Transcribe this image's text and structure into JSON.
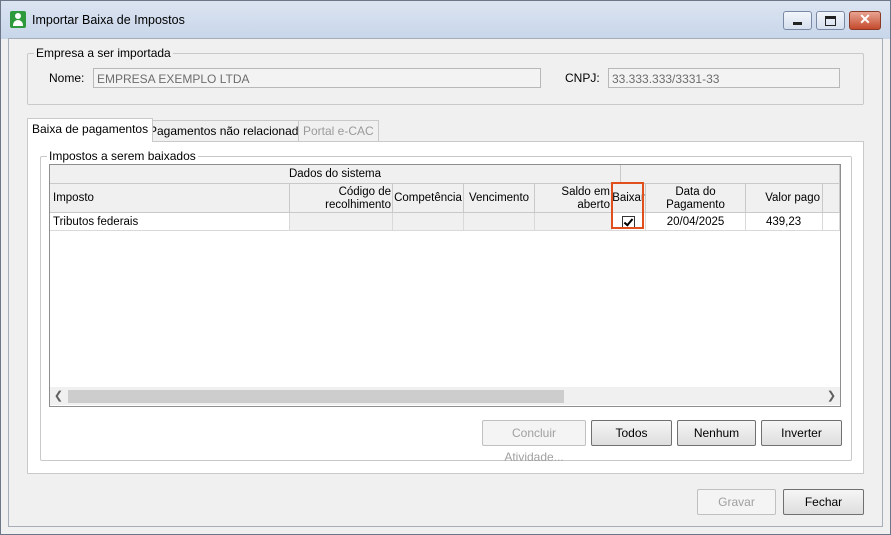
{
  "window": {
    "title": "Importar Baixa de Impostos"
  },
  "company": {
    "group_label": "Empresa a ser importada",
    "name_label": "Nome:",
    "name_value": "EMPRESA EXEMPLO LTDA",
    "cnpj_label": "CNPJ:",
    "cnpj_value": "33.333.333/3331-33"
  },
  "tabs": [
    {
      "label": "Baixa de pagamentos",
      "state": "active"
    },
    {
      "label": "Pagamentos não relacionados",
      "state": "normal"
    },
    {
      "label": "Portal e-CAC",
      "state": "disabled"
    }
  ],
  "taxes_group": {
    "label": "Impostos a serem baixados",
    "band_label": "Dados do sistema",
    "columns": [
      "Imposto",
      "Código de recolhimento",
      "Competência",
      "Vencimento",
      "Saldo em aberto",
      "Baixar",
      "Data do Pagamento",
      "Valor pago"
    ],
    "rows": [
      {
        "imposto": "Tributos federais",
        "codigo": "",
        "competencia": "",
        "vencimento": "",
        "saldo": "",
        "baixar": true,
        "data_pagamento": "20/04/2025",
        "valor_pago": "439,23"
      }
    ]
  },
  "grid_buttons": {
    "concluir": "Concluir Atividade...",
    "todos": "Todos",
    "nenhum": "Nenhum",
    "inverter": "Inverter"
  },
  "footer_buttons": {
    "gravar": "Gravar",
    "fechar": "Fechar"
  },
  "colors": {
    "highlight": "#e0501c",
    "titlebar": "#c8d6ea",
    "close_button": "#c44a2c"
  }
}
